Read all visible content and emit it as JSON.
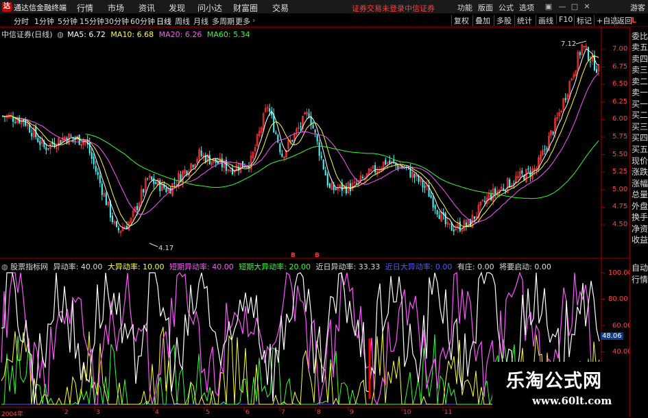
{
  "menubar": {
    "logo": "达",
    "app_title": "通达信金融终端",
    "items": [
      "行情",
      "市场",
      "资讯",
      "发现",
      "问小达",
      "财富圈",
      "交易"
    ],
    "notice_login": "证券交易未登录",
    "notice_broker": "中信证券",
    "right_items": [
      "功能",
      "版面",
      "公式",
      "选项"
    ],
    "guest": "游客"
  },
  "toolbar": {
    "periods": [
      "分时",
      "1分钟",
      "5分钟",
      "15分钟",
      "30分钟",
      "60分钟",
      "日线",
      "周线",
      "月线",
      "多周期",
      "更多"
    ],
    "active_period": "日线",
    "tools": [
      "复权",
      "叠加",
      "多股",
      "统计",
      "画线",
      "F10",
      "标记",
      "+自选",
      "返回"
    ]
  },
  "main_chart": {
    "stock_label": "中信证券(日线)",
    "ma": [
      {
        "label": "MA5: 6.72",
        "color": "#ffffff"
      },
      {
        "label": "MA10: 6.68",
        "color": "#ffff33"
      },
      {
        "label": "MA20: 6.26",
        "color": "#ff55ff"
      },
      {
        "label": "MA60: 5.34",
        "color": "#33ff33"
      }
    ],
    "y_ticks": [
      "7.00",
      "6.75",
      "6.50",
      "6.25",
      "6.00",
      "5.75",
      "5.50",
      "5.25",
      "5.00",
      "4.75",
      "4.50"
    ],
    "high_label": "7.12",
    "low_label": "4.17",
    "high_price": 7.12,
    "low_price": 4.17
  },
  "indicator": {
    "name": "股票指标网",
    "params": [
      {
        "label": "异动率:",
        "value": "40.00",
        "color": "#dddddd"
      },
      {
        "label": "大异动率:",
        "value": "10.00",
        "color": "#ffff33"
      },
      {
        "label": "短期异动率:",
        "value": "40.00",
        "color": "#ff55ff"
      },
      {
        "label": "短期大异动率:",
        "value": "20.00",
        "color": "#33ff33"
      },
      {
        "label": "近日异动率:",
        "value": "33.33",
        "color": "#dddddd"
      },
      {
        "label": "近日大异动率:",
        "value": "0.00",
        "color": "#5555ff"
      },
      {
        "label": "有庄:",
        "value": "0.00",
        "color": "#dddddd"
      },
      {
        "label": "将要启动:",
        "value": "0.00",
        "color": "#dddddd"
      }
    ],
    "y_ticks": [
      "100.00",
      "80.00",
      "60.00",
      "40.00"
    ],
    "current_value": "48.06",
    "markers": [
      "B",
      "B"
    ]
  },
  "right_panel": {
    "top_badge": "L",
    "items": [
      "委比",
      "卖五",
      "卖四",
      "卖三",
      "卖二",
      "卖一",
      "买一",
      "买二",
      "买三",
      "买四",
      "买五",
      "现价",
      "涨跌",
      "涨幅",
      "总量",
      "外盘",
      "换手",
      "净资",
      "收益",
      "自动",
      "行情"
    ]
  },
  "x_dates": [
    "2004年",
    "2",
    "3",
    "4",
    "5",
    "6",
    "7",
    "8",
    "9",
    "10",
    "11"
  ],
  "watermark": {
    "title": "乐淘公式网",
    "url": "www.60lt.com"
  },
  "colors": {
    "up": "#ff3333",
    "down": "#44ffff",
    "axis": "#aa0000",
    "ma5": "#ffffff",
    "ma10": "#ffff33",
    "ma20": "#ff55ff",
    "ma60": "#33ff33"
  }
}
